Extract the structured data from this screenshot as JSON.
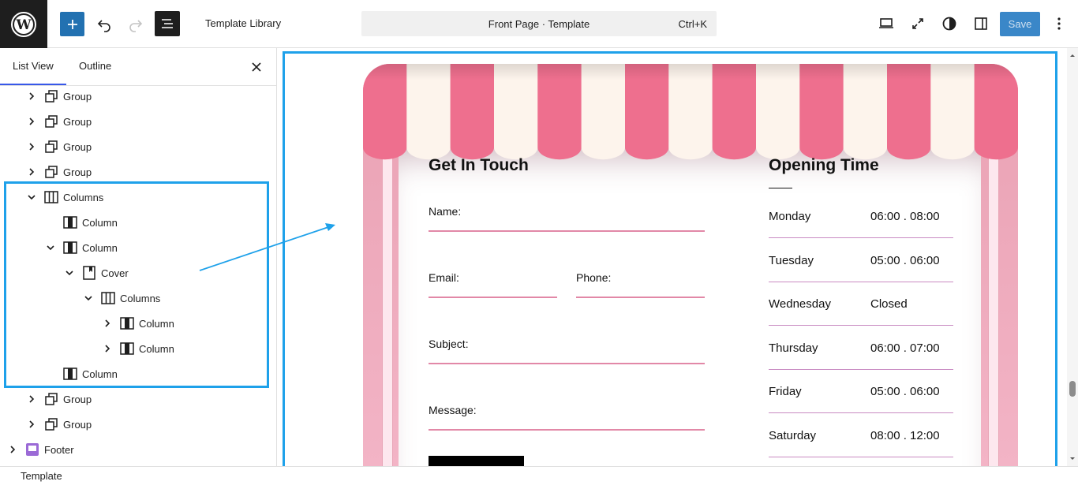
{
  "toolbar": {
    "title": "Template Library",
    "command_title": "Front Page · Template",
    "command_shortcut": "Ctrl+K",
    "save_label": "Save"
  },
  "panel": {
    "tabs": [
      "List View",
      "Outline"
    ],
    "active_tab": "List View",
    "items": [
      {
        "label": "Group",
        "icon": "group-icon",
        "depth": 1,
        "chevron": "right"
      },
      {
        "label": "Group",
        "icon": "group-icon",
        "depth": 1,
        "chevron": "right"
      },
      {
        "label": "Group",
        "icon": "group-icon",
        "depth": 1,
        "chevron": "right"
      },
      {
        "label": "Group",
        "icon": "group-icon",
        "depth": 1,
        "chevron": "right"
      },
      {
        "label": "Columns",
        "icon": "columns-icon",
        "depth": 1,
        "chevron": "down"
      },
      {
        "label": "Column",
        "icon": "column-icon",
        "depth": 2,
        "chevron": "none"
      },
      {
        "label": "Column",
        "icon": "column-icon",
        "depth": 2,
        "chevron": "down"
      },
      {
        "label": "Cover",
        "icon": "cover-icon",
        "depth": 3,
        "chevron": "down"
      },
      {
        "label": "Columns",
        "icon": "columns-icon",
        "depth": 4,
        "chevron": "down"
      },
      {
        "label": "Column",
        "icon": "column-icon",
        "depth": 5,
        "chevron": "right"
      },
      {
        "label": "Column",
        "icon": "column-icon",
        "depth": 5,
        "chevron": "right"
      },
      {
        "label": "Column",
        "icon": "column-icon",
        "depth": 2,
        "chevron": "none"
      },
      {
        "label": "Group",
        "icon": "group-icon",
        "depth": 1,
        "chevron": "right"
      },
      {
        "label": "Group",
        "icon": "group-icon",
        "depth": 1,
        "chevron": "right"
      },
      {
        "label": "Footer",
        "icon": "footer-icon",
        "depth": 0,
        "chevron": "right"
      }
    ]
  },
  "breadcrumb": "Template",
  "page": {
    "form_title": "Get In Touch",
    "name_label": "Name:",
    "email_label": "Email:",
    "phone_label": "Phone:",
    "subject_label": "Subject:",
    "message_label": "Message:",
    "hours_title": "Opening Time",
    "hours": [
      {
        "day": "Monday",
        "time": "06:00 . 08:00"
      },
      {
        "day": "Tuesday",
        "time": "05:00 . 06:00"
      },
      {
        "day": "Wednesday",
        "time": "Closed"
      },
      {
        "day": "Thursday",
        "time": "06:00 . 07:00"
      },
      {
        "day": "Friday",
        "time": "05:00 . 06:00"
      },
      {
        "day": "Saturday",
        "time": "08:00 . 12:00"
      }
    ]
  },
  "colors": {
    "accent": "#1ea1ea",
    "wp_blue": "#2271b1",
    "awning_pink": "#ee6f8e",
    "awning_cream": "#fdf4ec",
    "field_line": "#e288a7"
  }
}
